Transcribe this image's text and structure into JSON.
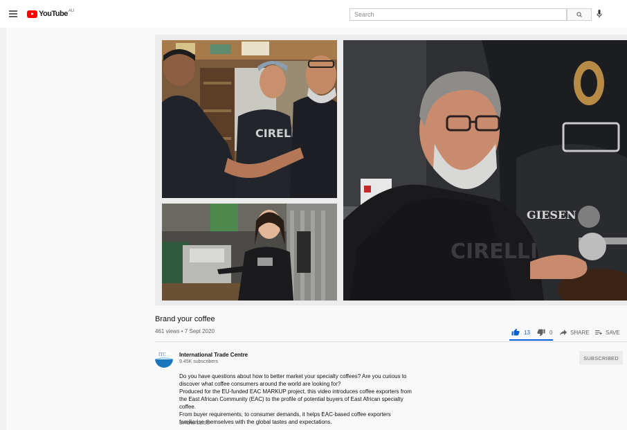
{
  "header": {
    "logo_text": "YouTube",
    "region": "AU",
    "search_placeholder": "Search"
  },
  "video": {
    "title": "Brand your coffee",
    "meta": "461 views • 7 Sept 2020",
    "actions": {
      "like_count": "13",
      "dislike_count": "0",
      "share_label": "SHARE",
      "save_label": "SAVE"
    }
  },
  "channel": {
    "logo_text": "ITC",
    "name": "International Trade Centre",
    "subscribers": "9.45K subscribers",
    "subscribed_label": "SUBSCRIBED"
  },
  "description": {
    "paragraphs": [
      "Do you have questions about how to better market your specialty coffees? Are you curious to discover what coffee consumers around the world are looking for?",
      "Produced for the EU-funded EAC MARKUP project, this video introduces coffee exporters from the East African Community (EAC) to the profile of potential buyers of East African specialty coffee.",
      "From buyer requirements, to consumer demands, it helps EAC-based coffee exporters familiarise themselves with the global tastes and expectations."
    ],
    "show_less_label": "SHOW LESS"
  },
  "thumbnail": {
    "shirt_text": "CIRELLI",
    "machine_brand": "GIESEN"
  },
  "colors": {
    "accent": "#065fd4",
    "logo_red": "#ff0000"
  }
}
